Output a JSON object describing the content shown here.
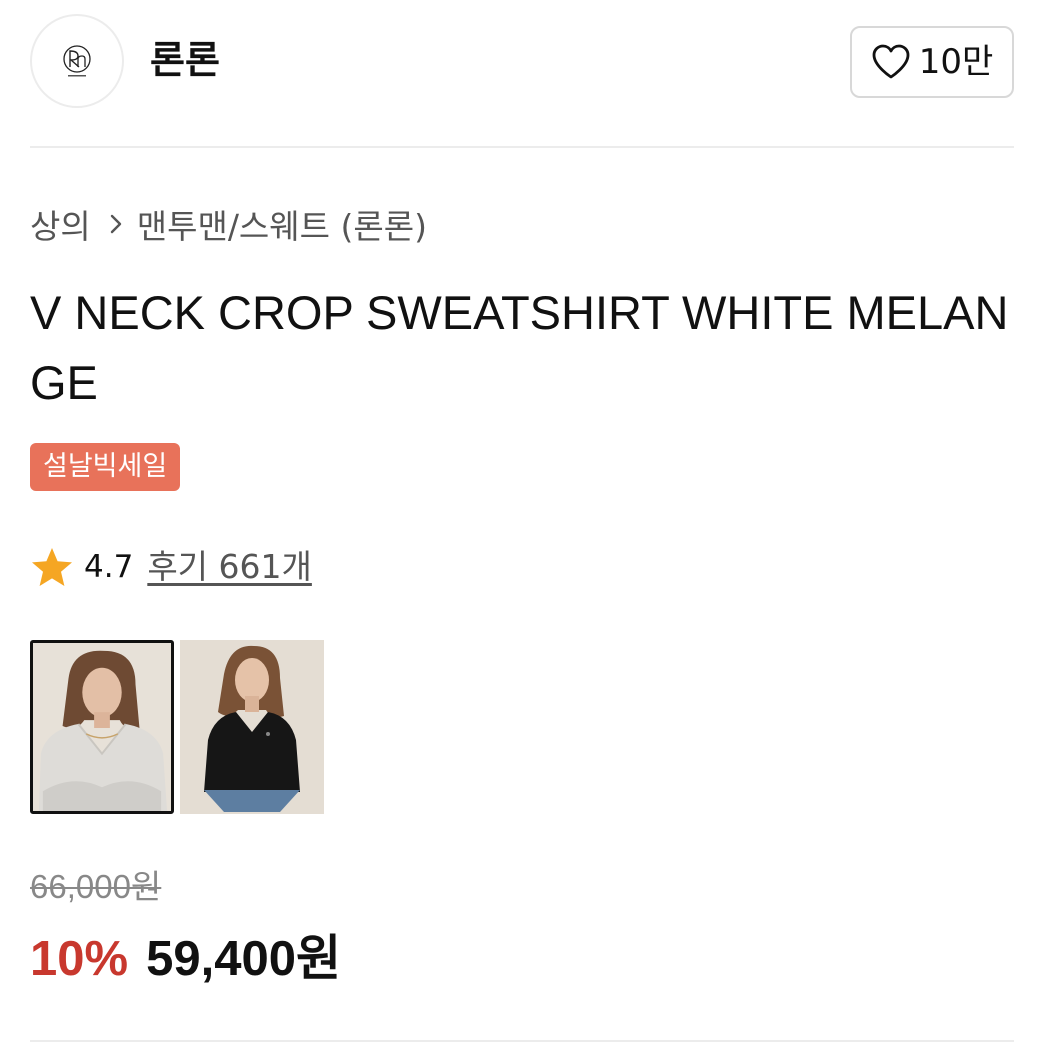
{
  "store": {
    "name": "론론",
    "like_count": "10만",
    "logo_icon": "ron-monogram-logo"
  },
  "breadcrumb": {
    "category": "상의",
    "subcategory": "맨투맨/스웨트 (론론)"
  },
  "product": {
    "title": "V NECK CROP SWEATSHIRT WHITE MELANGE",
    "badge": "설날빅세일",
    "rating": "4.7",
    "reviews_label": "후기 661개",
    "original_price": "66,000원",
    "discount_rate": "10%",
    "sale_price": "59,400원"
  },
  "thumbnails": [
    {
      "description_icon": "model-white-sweatshirt-photo",
      "selected": true
    },
    {
      "description_icon": "model-black-sweatshirt-photo",
      "selected": false
    }
  ],
  "colors": {
    "badge_bg": "#e8725a",
    "discount": "#c8382e",
    "star": "#f5a623"
  }
}
